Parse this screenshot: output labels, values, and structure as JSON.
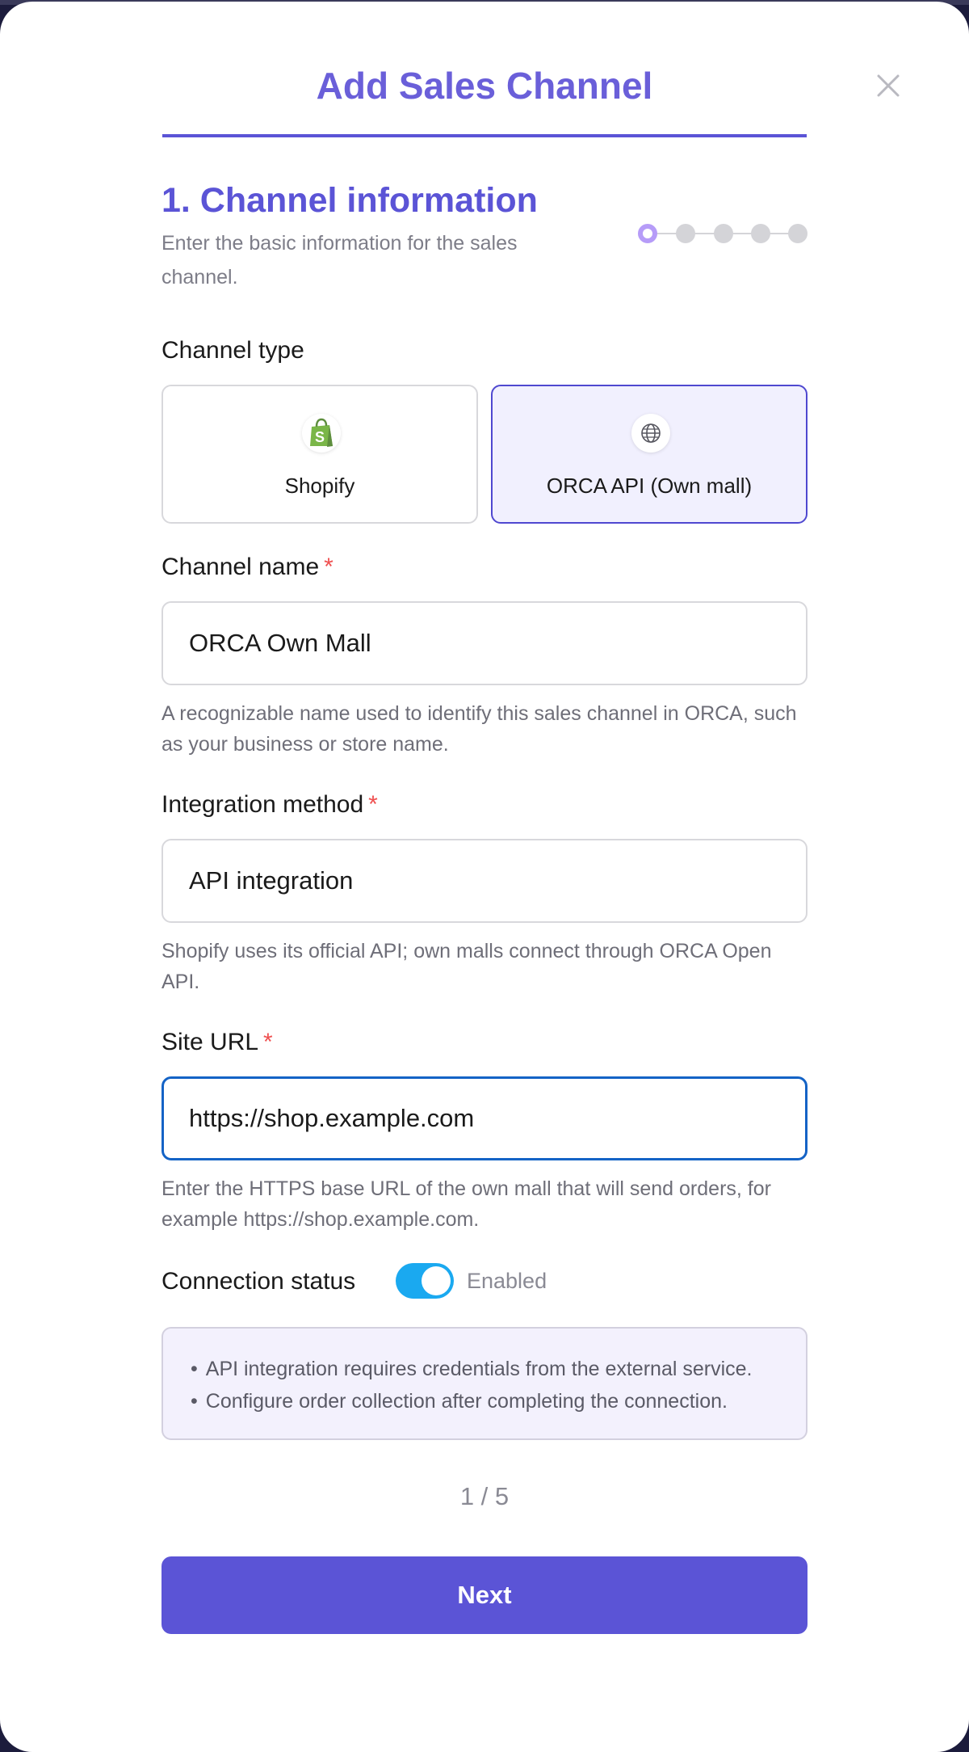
{
  "modal": {
    "title": "Add Sales Channel",
    "close_icon": "close-icon"
  },
  "step": {
    "title": "1. Channel information",
    "subtitle": "Enter the basic information for the sales channel.",
    "total_steps": 5,
    "current_step": 1
  },
  "channel_type": {
    "label": "Channel type",
    "options": [
      {
        "label": "Shopify",
        "icon": "shopify-icon",
        "selected": false
      },
      {
        "label": "ORCA API (Own mall)",
        "icon": "globe-icon",
        "selected": true
      }
    ]
  },
  "channel_name": {
    "label": "Channel name",
    "required_mark": "*",
    "value": "ORCA Own Mall",
    "help": "A recognizable name used to identify this sales channel in ORCA, such as your business or store name."
  },
  "integration_method": {
    "label": "Integration method",
    "required_mark": "*",
    "value": "API integration",
    "help": "Shopify uses its official API; own malls connect through ORCA Open API."
  },
  "site_url": {
    "label": "Site URL",
    "required_mark": "*",
    "value": "https://shop.example.com",
    "help": "Enter the HTTPS base URL of the own mall that will send orders, for example https://shop.example.com."
  },
  "connection_status": {
    "label": "Connection status",
    "enabled": true,
    "state_text": "Enabled"
  },
  "notice": {
    "bullet": "•",
    "lines": [
      "API integration requires credentials from the external service.",
      "Configure order collection after completing the connection."
    ]
  },
  "pagination": {
    "text": "1 / 5"
  },
  "actions": {
    "next_label": "Next"
  },
  "colors": {
    "accent": "#5b54d6",
    "title": "#6a5fd9",
    "toggle_on": "#1aa9f0",
    "required": "#ef5050",
    "focus_border": "#1463c6"
  }
}
